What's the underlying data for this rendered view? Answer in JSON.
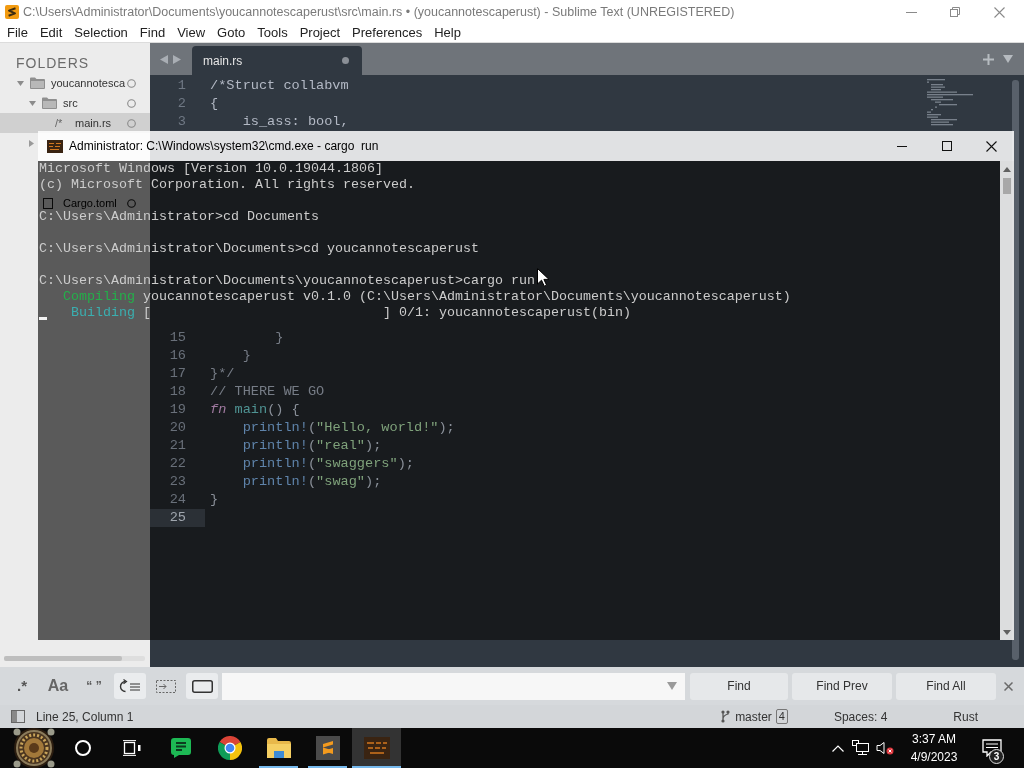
{
  "window": {
    "title": "C:\\Users\\Administrator\\Documents\\youcannotescaperust\\src\\main.rs • (youcannotescaperust) - Sublime Text (UNREGISTERED)"
  },
  "menu": [
    "File",
    "Edit",
    "Selection",
    "Find",
    "View",
    "Goto",
    "Tools",
    "Project",
    "Preferences",
    "Help"
  ],
  "sidebar": {
    "heading": "FOLDERS",
    "tree": [
      {
        "kind": "folder",
        "label": "youcannotesca",
        "expanded": true,
        "selected": false,
        "children": [
          {
            "kind": "folder",
            "label": "src",
            "expanded": true,
            "selected": false,
            "children": [
              {
                "kind": "file",
                "glyph": "/*",
                "label": "main.rs",
                "selected": true
              }
            ]
          },
          {
            "kind": "folder",
            "expanded": false,
            "selected": false
          },
          {
            "kind": "file",
            "label": "Cargo.toml",
            "selected": false
          }
        ]
      }
    ]
  },
  "tabs": [
    {
      "label": "main.rs",
      "selected": true,
      "modified": true
    }
  ],
  "editor": {
    "lines": [
      {
        "number": "1",
        "current": false,
        "tokens": [
          {
            "kind": "comment",
            "text": "/*Struct collabvm"
          }
        ]
      },
      {
        "number": "2",
        "current": false,
        "tokens": [
          {
            "kind": "comment",
            "text": "{"
          }
        ]
      },
      {
        "number": "3",
        "current": false,
        "tokens": [
          {
            "kind": "comment",
            "text": "    is_ass: bool,"
          }
        ]
      }
    ],
    "lines_behind_console": [
      {
        "number": "15",
        "current": false,
        "tokens": [
          {
            "kind": "comment",
            "text": "        }"
          }
        ]
      },
      {
        "number": "16",
        "current": false,
        "tokens": [
          {
            "kind": "comment",
            "text": "    }"
          }
        ]
      },
      {
        "number": "17",
        "current": false,
        "tokens": [
          {
            "kind": "comment",
            "text": "}*/"
          }
        ]
      },
      {
        "number": "18",
        "current": false,
        "tokens": [
          {
            "kind": "comment",
            "text": "// THERE WE GO"
          }
        ]
      },
      {
        "number": "19",
        "current": false,
        "tokens": [
          {
            "kind": "keyword",
            "text": "fn"
          },
          {
            "kind": "function",
            "text": " main"
          },
          {
            "kind": "plain",
            "text": "() {"
          }
        ]
      },
      {
        "number": "20",
        "current": false,
        "tokens": [
          {
            "kind": "macro",
            "text": "    println!"
          },
          {
            "kind": "plain",
            "text": "("
          },
          {
            "kind": "string",
            "text": "\"Hello, world!\""
          },
          {
            "kind": "plain",
            "text": ");"
          }
        ]
      },
      {
        "number": "21",
        "current": false,
        "tokens": [
          {
            "kind": "macro",
            "text": "    println!"
          },
          {
            "kind": "plain",
            "text": "("
          },
          {
            "kind": "string",
            "text": "\"real\""
          },
          {
            "kind": "plain",
            "text": ");"
          }
        ]
      },
      {
        "number": "22",
        "current": false,
        "tokens": [
          {
            "kind": "macro",
            "text": "    println!"
          },
          {
            "kind": "plain",
            "text": "("
          },
          {
            "kind": "string",
            "text": "\"swaggers\""
          },
          {
            "kind": "plain",
            "text": ");"
          }
        ]
      },
      {
        "number": "23",
        "current": false,
        "tokens": [
          {
            "kind": "macro",
            "text": "    println!"
          },
          {
            "kind": "plain",
            "text": "("
          },
          {
            "kind": "string",
            "text": "\"swag\""
          },
          {
            "kind": "plain",
            "text": ");"
          }
        ]
      },
      {
        "number": "24",
        "current": false,
        "tokens": [
          {
            "kind": "plain",
            "text": "}"
          }
        ]
      },
      {
        "number": "25",
        "current": true
      }
    ]
  },
  "find_bar": {
    "options": [
      {
        "kind": "regex",
        "glyph": ".*",
        "on": false
      },
      {
        "kind": "case",
        "glyph": "Aa",
        "on": false
      },
      {
        "kind": "whole_word",
        "glyph": "“ ”",
        "on": false
      },
      {
        "kind": "wrap",
        "on": true
      },
      {
        "kind": "in_selection",
        "on": false
      },
      {
        "kind": "highlight",
        "on": true
      }
    ],
    "buttons": [
      "Find",
      "Find Prev",
      "Find All"
    ]
  },
  "status_bar": {
    "position": "Line 25, Column 1",
    "branch": "master",
    "branch_badge": "4",
    "indentation": "Spaces: 4",
    "syntax": "Rust"
  },
  "console": {
    "title": "Administrator: C:\\Windows\\system32\\cmd.exe - cargo  run",
    "lines": [
      {
        "kind": "text",
        "cursor": false,
        "segments": [
          {
            "text": "Microsoft Windows [Version 10.0.19044.1806]"
          }
        ]
      },
      {
        "kind": "text",
        "cursor": false,
        "segments": [
          {
            "text": "(c) Microsoft Corporation. All rights reserved."
          }
        ]
      },
      {
        "kind": "blank",
        "cursor": false
      },
      {
        "kind": "text",
        "cursor": false,
        "segments": [
          {
            "text": "C:\\Users\\Administrator>cd Documents"
          }
        ]
      },
      {
        "kind": "blank",
        "cursor": false
      },
      {
        "kind": "text",
        "cursor": false,
        "segments": [
          {
            "text": "C:\\Users\\Administrator\\Documents>cd youcannotescaperust"
          }
        ]
      },
      {
        "kind": "blank",
        "cursor": false
      },
      {
        "kind": "text",
        "cursor": false,
        "segments": [
          {
            "text": "C:\\Users\\Administrator\\Documents\\youcannotescaperust>cargo run"
          }
        ]
      },
      {
        "kind": "text",
        "cursor": false,
        "segments": [
          {
            "text": "   Compiling",
            "color": "#23b04a"
          },
          {
            "text": " youcannotescaperust v0.1.0 (C:\\Users\\Administrator\\Documents\\youcannotescaperust)"
          }
        ]
      },
      {
        "kind": "text",
        "cursor": true,
        "segments": [
          {
            "text": "    Building",
            "color": "#3aafb0"
          },
          {
            "text": " [                             ] 0/1: youcannotescaperust(bin)"
          }
        ]
      }
    ]
  },
  "taskbar": {
    "apps": [
      {
        "kind": "start",
        "running": false,
        "selected": false
      },
      {
        "kind": "search",
        "running": false,
        "selected": false
      },
      {
        "kind": "task_view",
        "running": false,
        "selected": false
      },
      {
        "kind": "notes",
        "running": false,
        "selected": false
      },
      {
        "kind": "browser",
        "running": false,
        "selected": false
      },
      {
        "kind": "files",
        "running": true,
        "selected": false
      },
      {
        "kind": "editor",
        "running": true,
        "selected": false
      },
      {
        "kind": "terminal",
        "running": true,
        "selected": true
      }
    ],
    "tray": {
      "volume_muted": true
    },
    "clock": {
      "time": "3:37 AM",
      "date": "4/9/2023"
    },
    "notification_count": "3"
  }
}
